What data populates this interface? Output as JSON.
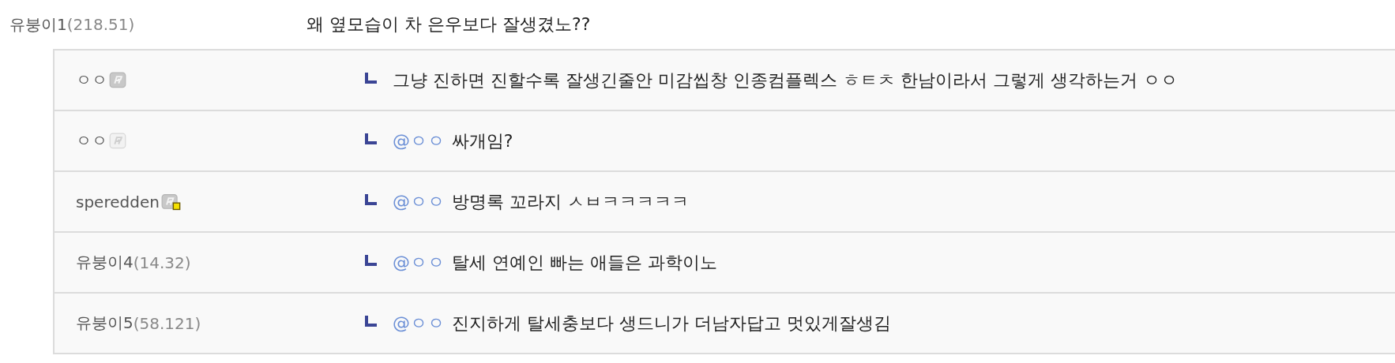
{
  "comment": {
    "author": "유붕이1",
    "ip": "(218.51)",
    "text": "왜 옆모습이 차 은우보다 잘생겼노??"
  },
  "replies": [
    {
      "author": "ㅇㅇ",
      "kind": "solid",
      "text": "그냥 진하면 진할수록 잘생긴줄안 미감씹창 인종컴플렉스 ㅎㅌㅊ 한남이라서 그렇게 생각하는거 ㅇㅇ"
    },
    {
      "author": "ㅇㅇ",
      "kind": "faded",
      "mention": "@ㅇㅇ",
      "text": "싸개임?"
    },
    {
      "author": "speredden",
      "kind": "manager",
      "mention": "@ㅇㅇ",
      "text": "방명록 꼬라지 ㅅㅂㅋㅋㅋㅋㅋ"
    },
    {
      "author": "유붕이4",
      "ip": "(14.32)",
      "mention": "@ㅇㅇ",
      "text": "탈세 연예인 빠는 애들은 과학이노"
    },
    {
      "author": "유붕이5",
      "ip": "(58.121)",
      "mention": "@ㅇㅇ",
      "text": "진지하게 탈세충보다 생드니가 더남자답고 멋있게잘생김"
    }
  ]
}
